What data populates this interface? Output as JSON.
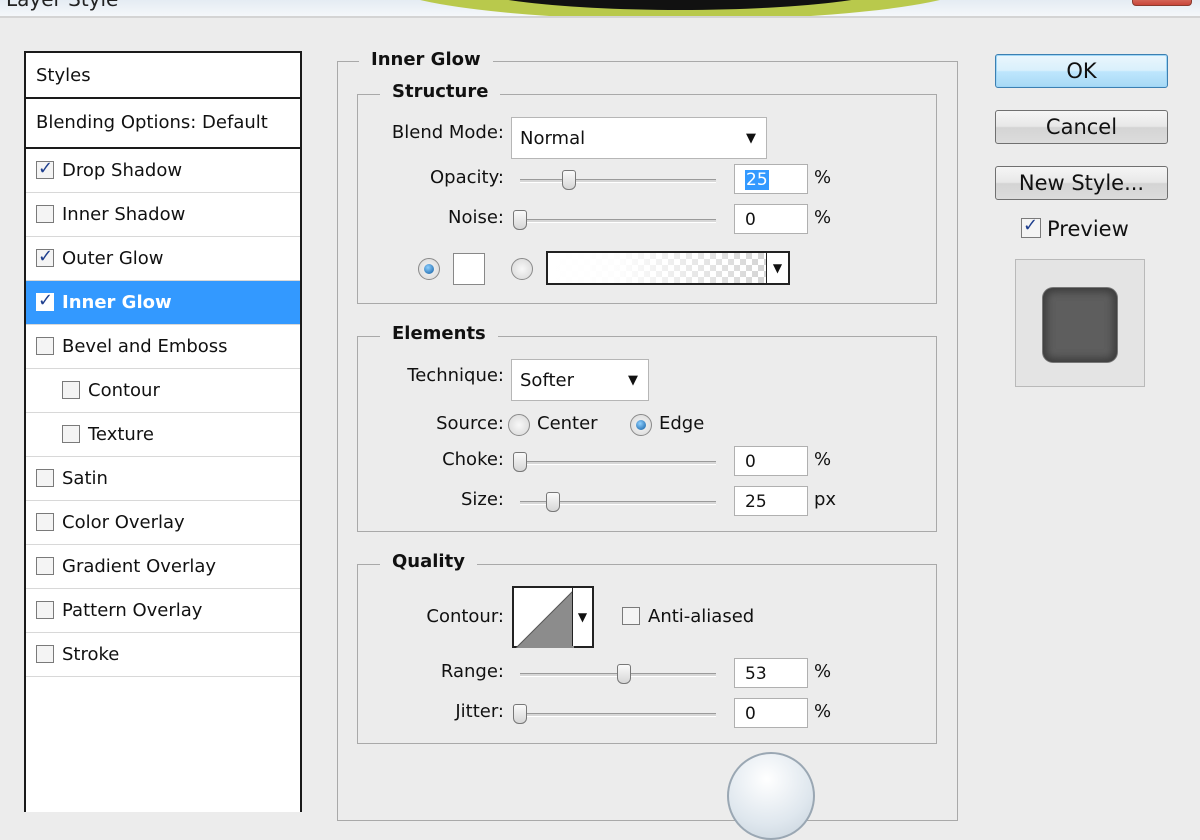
{
  "window": {
    "title": "Layer Style"
  },
  "styles_list": {
    "header": "Styles",
    "blending": "Blending Options: Default",
    "items": [
      {
        "label": "Drop Shadow",
        "checked": true,
        "indent": false,
        "selected": false
      },
      {
        "label": "Inner Shadow",
        "checked": false,
        "indent": false,
        "selected": false
      },
      {
        "label": "Outer Glow",
        "checked": true,
        "indent": false,
        "selected": false
      },
      {
        "label": "Inner Glow",
        "checked": true,
        "indent": false,
        "selected": true
      },
      {
        "label": "Bevel and Emboss",
        "checked": false,
        "indent": false,
        "selected": false
      },
      {
        "label": "Contour",
        "checked": false,
        "indent": true,
        "selected": false
      },
      {
        "label": "Texture",
        "checked": false,
        "indent": true,
        "selected": false
      },
      {
        "label": "Satin",
        "checked": false,
        "indent": false,
        "selected": false
      },
      {
        "label": "Color Overlay",
        "checked": false,
        "indent": false,
        "selected": false
      },
      {
        "label": "Gradient Overlay",
        "checked": false,
        "indent": false,
        "selected": false
      },
      {
        "label": "Pattern Overlay",
        "checked": false,
        "indent": false,
        "selected": false
      },
      {
        "label": "Stroke",
        "checked": false,
        "indent": false,
        "selected": false
      }
    ]
  },
  "panel": {
    "title": "Inner Glow",
    "structure": {
      "title": "Structure",
      "blend_mode_label": "Blend Mode:",
      "blend_mode_value": "Normal",
      "opacity_label": "Opacity:",
      "opacity_value": "25",
      "opacity_unit": "%",
      "opacity_level": 0.25,
      "noise_label": "Noise:",
      "noise_value": "0",
      "noise_unit": "%",
      "noise_level": 0,
      "fill_mode": "color",
      "color_swatch": "#ffffff"
    },
    "elements": {
      "title": "Elements",
      "technique_label": "Technique:",
      "technique_value": "Softer",
      "source_label": "Source:",
      "source_center": "Center",
      "source_edge": "Edge",
      "source_selected": "Edge",
      "choke_label": "Choke:",
      "choke_value": "0",
      "choke_unit": "%",
      "choke_level": 0,
      "size_label": "Size:",
      "size_value": "25",
      "size_unit": "px",
      "size_level": 0.17
    },
    "quality": {
      "title": "Quality",
      "contour_label": "Contour:",
      "anti_aliased_label": "Anti-aliased",
      "anti_aliased": false,
      "range_label": "Range:",
      "range_value": "53",
      "range_unit": "%",
      "range_level": 0.53,
      "jitter_label": "Jitter:",
      "jitter_value": "0",
      "jitter_unit": "%",
      "jitter_level": 0
    }
  },
  "buttons": {
    "ok": "OK",
    "cancel": "Cancel",
    "new_style": "New Style..."
  },
  "preview": {
    "label": "Preview",
    "checked": true
  }
}
